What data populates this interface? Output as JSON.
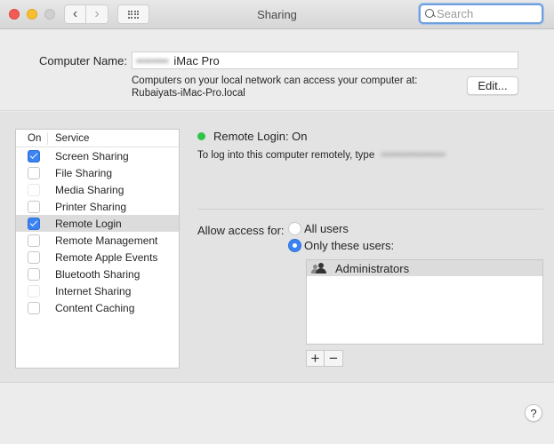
{
  "window": {
    "title": "Sharing",
    "search_placeholder": "Search",
    "search_value": ""
  },
  "computer_name": {
    "label": "Computer Name:",
    "value_redacted": "••••••••",
    "value_visible": "iMac Pro",
    "description_line1": "Computers on your local network can access your computer at:",
    "description_line2": "Rubaiyats-iMac-Pro.local",
    "edit_button": "Edit..."
  },
  "services": {
    "header_on": "On",
    "header_service": "Service",
    "items": [
      {
        "label": "Screen Sharing",
        "checked": true,
        "enabled": true
      },
      {
        "label": "File Sharing",
        "checked": false,
        "enabled": true
      },
      {
        "label": "Media Sharing",
        "checked": false,
        "enabled": false
      },
      {
        "label": "Printer Sharing",
        "checked": false,
        "enabled": true
      },
      {
        "label": "Remote Login",
        "checked": true,
        "enabled": true,
        "selected": true
      },
      {
        "label": "Remote Management",
        "checked": false,
        "enabled": true
      },
      {
        "label": "Remote Apple Events",
        "checked": false,
        "enabled": true
      },
      {
        "label": "Bluetooth Sharing",
        "checked": false,
        "enabled": true
      },
      {
        "label": "Internet Sharing",
        "checked": false,
        "enabled": false
      },
      {
        "label": "Content Caching",
        "checked": false,
        "enabled": true
      }
    ]
  },
  "detail": {
    "status_color": "#2ec44a",
    "status_text": "Remote Login: On",
    "description": "To log into this computer remotely, type",
    "description_redacted": "••••••••••••••••••",
    "access_label": "Allow access for:",
    "radio_all_users": "All users",
    "radio_only_these": "Only these users:",
    "selected_access": "only_these",
    "users": [
      {
        "label": "Administrators",
        "icon": "group-icon"
      }
    ],
    "add_button": "+",
    "remove_button": "−"
  },
  "help_button": "?"
}
